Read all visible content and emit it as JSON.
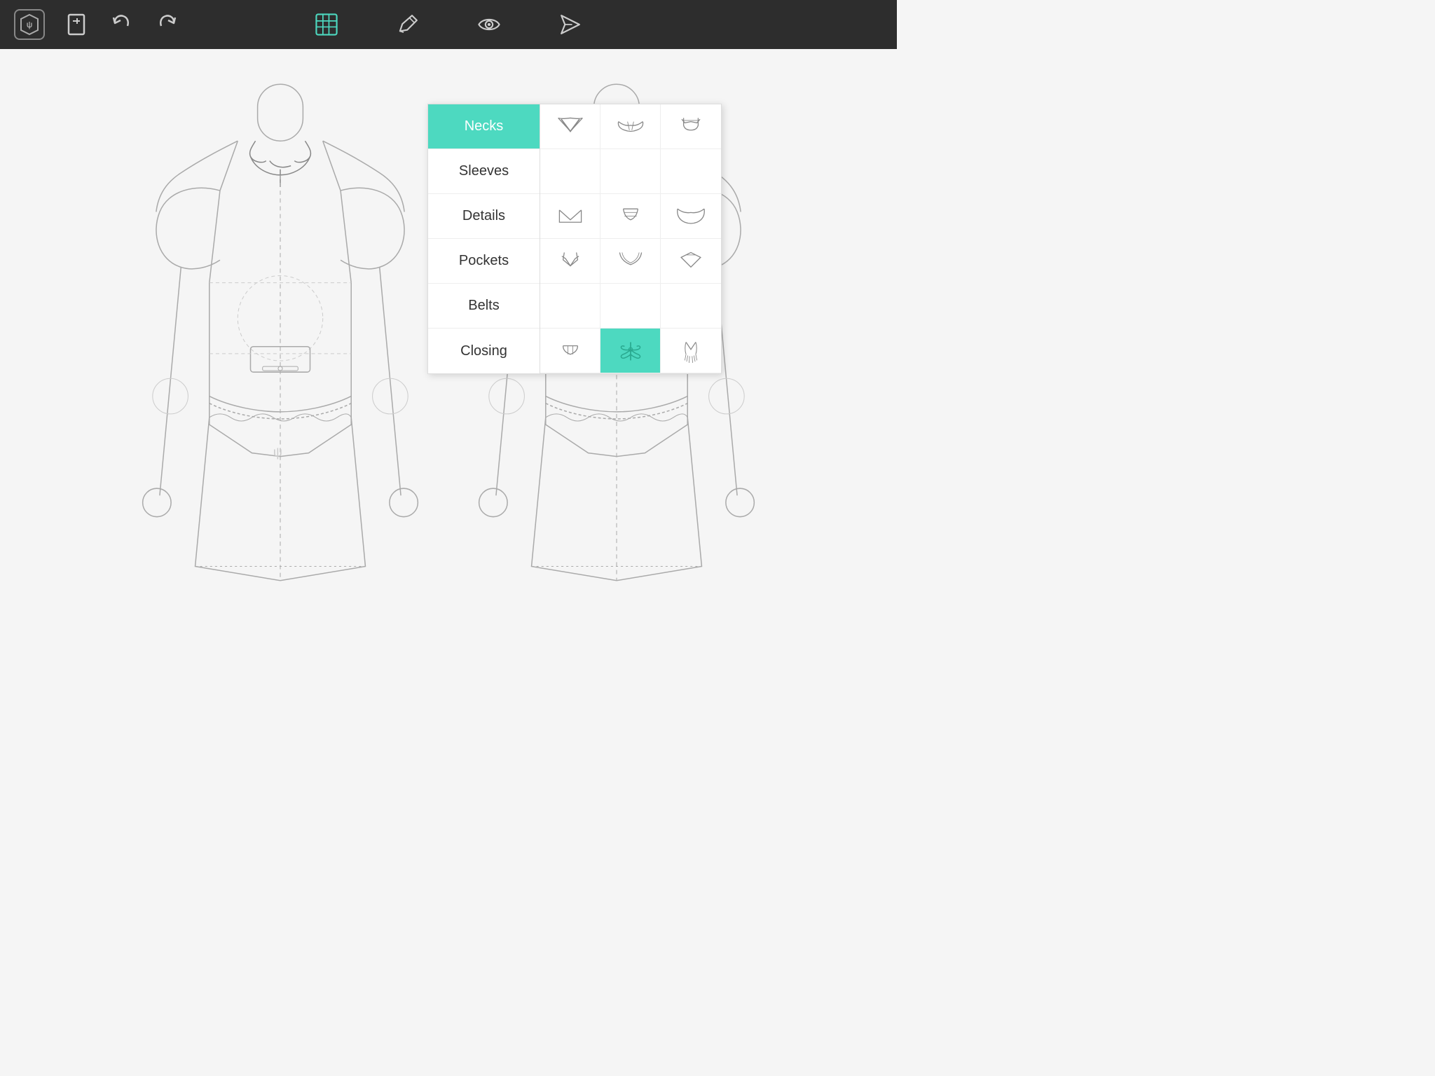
{
  "toolbar": {
    "logo_label": "logo",
    "new_label": "new",
    "undo_label": "undo",
    "redo_label": "redo",
    "grid_label": "grid",
    "edit_label": "edit",
    "preview_label": "preview",
    "send_label": "send"
  },
  "panel": {
    "categories": [
      {
        "id": "necks",
        "label": "Necks",
        "active": true
      },
      {
        "id": "sleeves",
        "label": "Sleeves",
        "active": false
      },
      {
        "id": "details",
        "label": "Details",
        "active": false
      },
      {
        "id": "pockets",
        "label": "Pockets",
        "active": false
      },
      {
        "id": "belts",
        "label": "Belts",
        "active": false
      },
      {
        "id": "closing",
        "label": "Closing",
        "active": false
      }
    ],
    "grid_rows": 6,
    "grid_cols": 3,
    "selected_cell": {
      "row": 5,
      "col": 1
    }
  }
}
